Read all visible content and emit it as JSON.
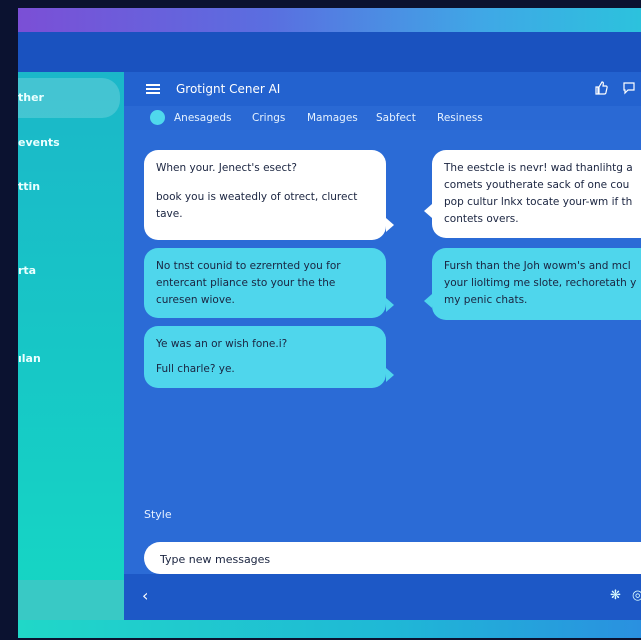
{
  "sidebar": {
    "items": [
      {
        "label": "ther"
      },
      {
        "label": "events"
      },
      {
        "label": "ttin"
      },
      {
        "label": "rta"
      },
      {
        "label": "ılan"
      }
    ]
  },
  "header": {
    "title": "Grotignt  Cener  AI",
    "icons": [
      "thumbs-up-icon",
      "chat-icon"
    ]
  },
  "tabs": [
    {
      "label": "Anesageds"
    },
    {
      "label": "Crings"
    },
    {
      "label": "Mamages"
    },
    {
      "label": "Sabfect"
    },
    {
      "label": "Resiness"
    }
  ],
  "messages": {
    "left": [
      {
        "lines": [
          "When your. Jenect's esect?",
          "book you is weatedly of otrect, clurect tave."
        ]
      },
      {
        "lines": [
          "No tnst counid to ezrernted you for entercant pliance sto your the the curesen wiove."
        ]
      },
      {
        "lines": [
          "Ye was an or wish fone.i?",
          "Full charle? ye."
        ]
      }
    ],
    "right": [
      {
        "lines": [
          "The eestcle is nevr! wad thanlihtg a",
          "comets youtherate sack of one cou",
          "pop cultur lnkx tocate your-wm if th",
          "contets overs."
        ]
      },
      {
        "lines": [
          "Fursh than the Joh wowm's and mcl",
          "your lioltimg me slote, rechoretath y",
          "my penic chats."
        ]
      }
    ]
  },
  "composer": {
    "style_label": "Style",
    "placeholder": "Type new messages"
  },
  "colors": {
    "accent": "#4fd6ec",
    "main_bg": "#2b6bd6",
    "sidebar": "#17c7c6"
  }
}
